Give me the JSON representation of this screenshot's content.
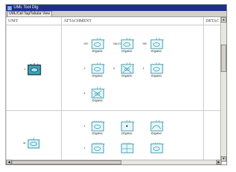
{
  "window": {
    "title": "UML Tool Dlg",
    "tab_label": "UML/Call Tag/Tabular View"
  },
  "columns": {
    "unit": "UNIT",
    "attachment": "ATTACHMENT",
    "detach": "DETAC"
  },
  "rows": [
    {
      "unit_prefix": "1",
      "attachments": [
        {
          "prefix": "GR",
          "label": "Organic",
          "shape": "empty"
        },
        {
          "prefix": "SACCH",
          "label": "Organic",
          "shape": "empty"
        },
        {
          "prefix": "NR",
          "label": "Organic",
          "shape": "empty"
        },
        {
          "prefix": "1",
          "label": "Organic",
          "shape": "empty"
        },
        {
          "prefix": "3",
          "label": "Organic",
          "shape": "cross"
        },
        {
          "prefix": "2",
          "label": "Organic",
          "shape": "empty"
        },
        {
          "prefix": "4",
          "label": "Organic",
          "shape": "cross"
        }
      ]
    },
    {
      "unit_prefix": "M",
      "attachments": [
        {
          "prefix": "1",
          "label": "Organic",
          "shape": "dots"
        },
        {
          "prefix": "",
          "label": "Organic",
          "shape": "dot"
        },
        {
          "prefix": "",
          "label": "Organic",
          "shape": "arc"
        },
        {
          "prefix": "1",
          "label": "",
          "shape": "dots"
        },
        {
          "prefix": "",
          "label": "",
          "shape": "grid"
        },
        {
          "prefix": "",
          "label": "",
          "shape": "dots"
        }
      ]
    }
  ],
  "scroll": {
    "up": "▲",
    "down": "▼",
    "left": "◀",
    "right": "▶"
  }
}
